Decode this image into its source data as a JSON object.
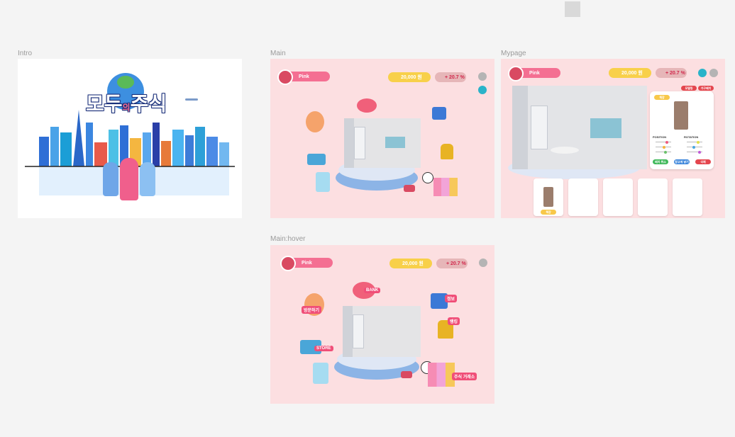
{
  "frames": {
    "intro": {
      "label": "Intro"
    },
    "main": {
      "label": "Main"
    },
    "mypage": {
      "label": "Mypage"
    },
    "main_hover": {
      "label": "Main:hover"
    }
  },
  "intro": {
    "logo_main": "모두",
    "logo_small": "의",
    "logo_end": "주식"
  },
  "header": {
    "username": "Pink",
    "money": "20,000 원",
    "rate": "+ 20.7 %"
  },
  "hover_labels": {
    "bank": "BANK",
    "visit": "방문하기",
    "store": "STORE",
    "trade": "주식 거래소",
    "news": "정보",
    "rank": "랭킹"
  },
  "mypage": {
    "tab1": "모델링",
    "tab2": "가구배치",
    "item_label": "책장",
    "position": "POSITION",
    "rotation": "ROTATION",
    "axes": [
      "X",
      "Y",
      "Z"
    ],
    "btn_cancel": "배치 취소",
    "btn_confirm": "창고에 넣기",
    "btn_delete": "삭제",
    "slot_label": "책장"
  },
  "colors": {
    "pink": "#f46f92",
    "gold": "#f8d04a",
    "bg": "#fcdfe1"
  }
}
